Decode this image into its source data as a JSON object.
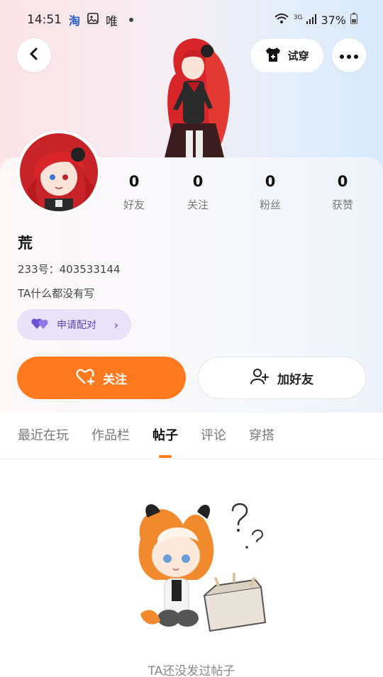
{
  "status_bar": {
    "time": "14:51",
    "app_icons": [
      "淘",
      "唯"
    ],
    "network": "3G",
    "battery": "37%"
  },
  "header": {
    "back_icon": "chevron-left-icon",
    "tryon_label": "试穿",
    "more_icon": "more-dots-icon"
  },
  "profile": {
    "name": "荒",
    "id_line": "233号：403533144",
    "bio": "TA什么都没有写",
    "pair_label": "申请配对"
  },
  "stats": [
    {
      "value": "0",
      "label": "好友"
    },
    {
      "value": "0",
      "label": "关注"
    },
    {
      "value": "0",
      "label": "粉丝"
    },
    {
      "value": "0",
      "label": "获赞"
    }
  ],
  "actions": {
    "follow_label": "关注",
    "add_friend_label": "加好友"
  },
  "tabs": [
    "最近在玩",
    "作品栏",
    "帖子",
    "评论",
    "穿搭"
  ],
  "active_tab": "帖子",
  "empty_state": {
    "text": "TA还没发过帖子"
  },
  "colors": {
    "accent": "#ff7a1f",
    "pair_bg": "#e8e3f8",
    "pair_fg": "#5a46b8"
  }
}
